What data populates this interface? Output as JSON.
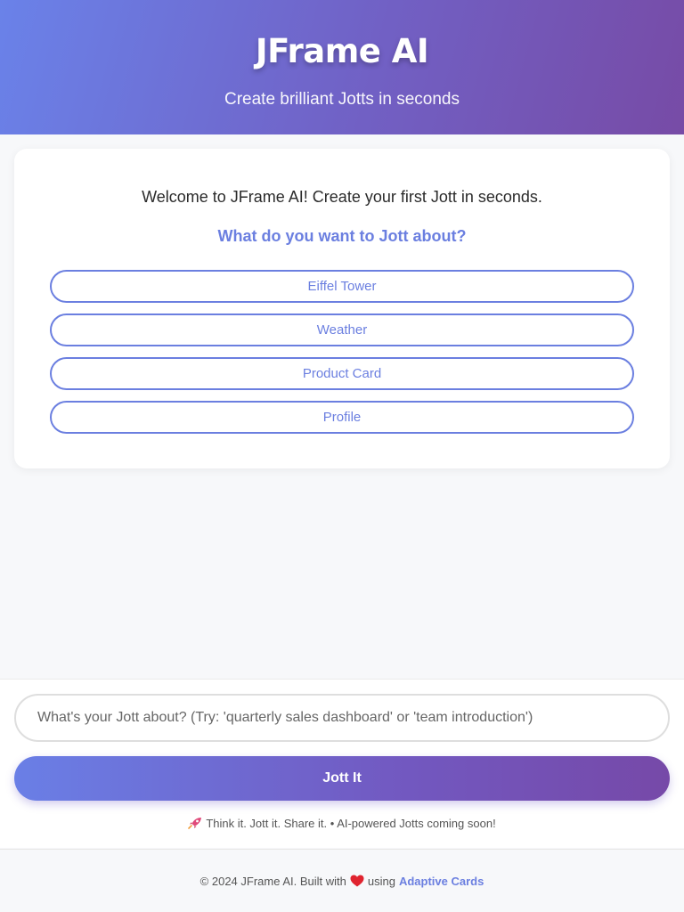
{
  "header": {
    "title": "JFrame AI",
    "subtitle": "Create brilliant Jotts in seconds"
  },
  "card": {
    "welcome": "Welcome to JFrame AI! Create your first Jott in seconds.",
    "prompt": "What do you want to Jott about?",
    "options": [
      "Eiffel Tower",
      "Weather",
      "Product Card",
      "Profile"
    ]
  },
  "composer": {
    "placeholder": "What's your Jott about? (Try: 'quarterly sales dashboard' or 'team introduction')",
    "button_label": "Jott It",
    "tagline_icon": "rocket-icon",
    "tagline": "Think it. Jott it. Share it. • AI-powered Jotts coming soon!"
  },
  "footer": {
    "prefix": "© 2024 JFrame AI. Built with",
    "heart_icon": "heart-icon",
    "middle": "using",
    "link_text": "Adaptive Cards"
  },
  "colors": {
    "accent": "#6b7fe0",
    "gradient_start": "#6a82e9",
    "gradient_end": "#774ba6",
    "heart": "#e0242f"
  }
}
